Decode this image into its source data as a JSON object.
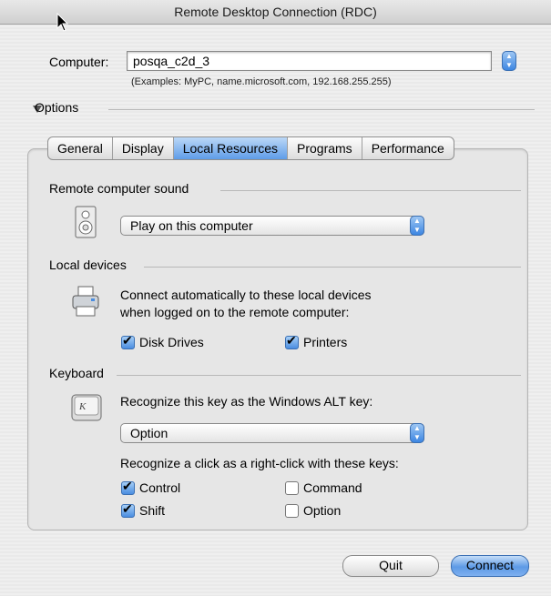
{
  "window": {
    "title": "Remote Desktop Connection (RDC)"
  },
  "computer": {
    "label": "Computer:",
    "value": "posqa_c2d_3",
    "hint": "(Examples: MyPC, name.microsoft.com, 192.168.255.255)"
  },
  "options": {
    "label": "Options"
  },
  "tabs": [
    "General",
    "Display",
    "Local Resources",
    "Programs",
    "Performance"
  ],
  "sound": {
    "heading": "Remote computer sound",
    "selected": "Play on this computer"
  },
  "devices": {
    "heading": "Local devices",
    "line1": "Connect automatically to these local devices",
    "line2": "when logged on to the remote computer:",
    "disk": "Disk Drives",
    "printers": "Printers"
  },
  "keyboard": {
    "heading": "Keyboard",
    "alt_prompt": "Recognize this key as the Windows ALT key:",
    "alt_selected": "Option",
    "right_click_prompt": "Recognize a click as a right-click with these keys:",
    "control": "Control",
    "command": "Command",
    "shift": "Shift",
    "option": "Option"
  },
  "buttons": {
    "quit": "Quit",
    "connect": "Connect"
  },
  "colors": {
    "accent": "#5e9ce8"
  }
}
